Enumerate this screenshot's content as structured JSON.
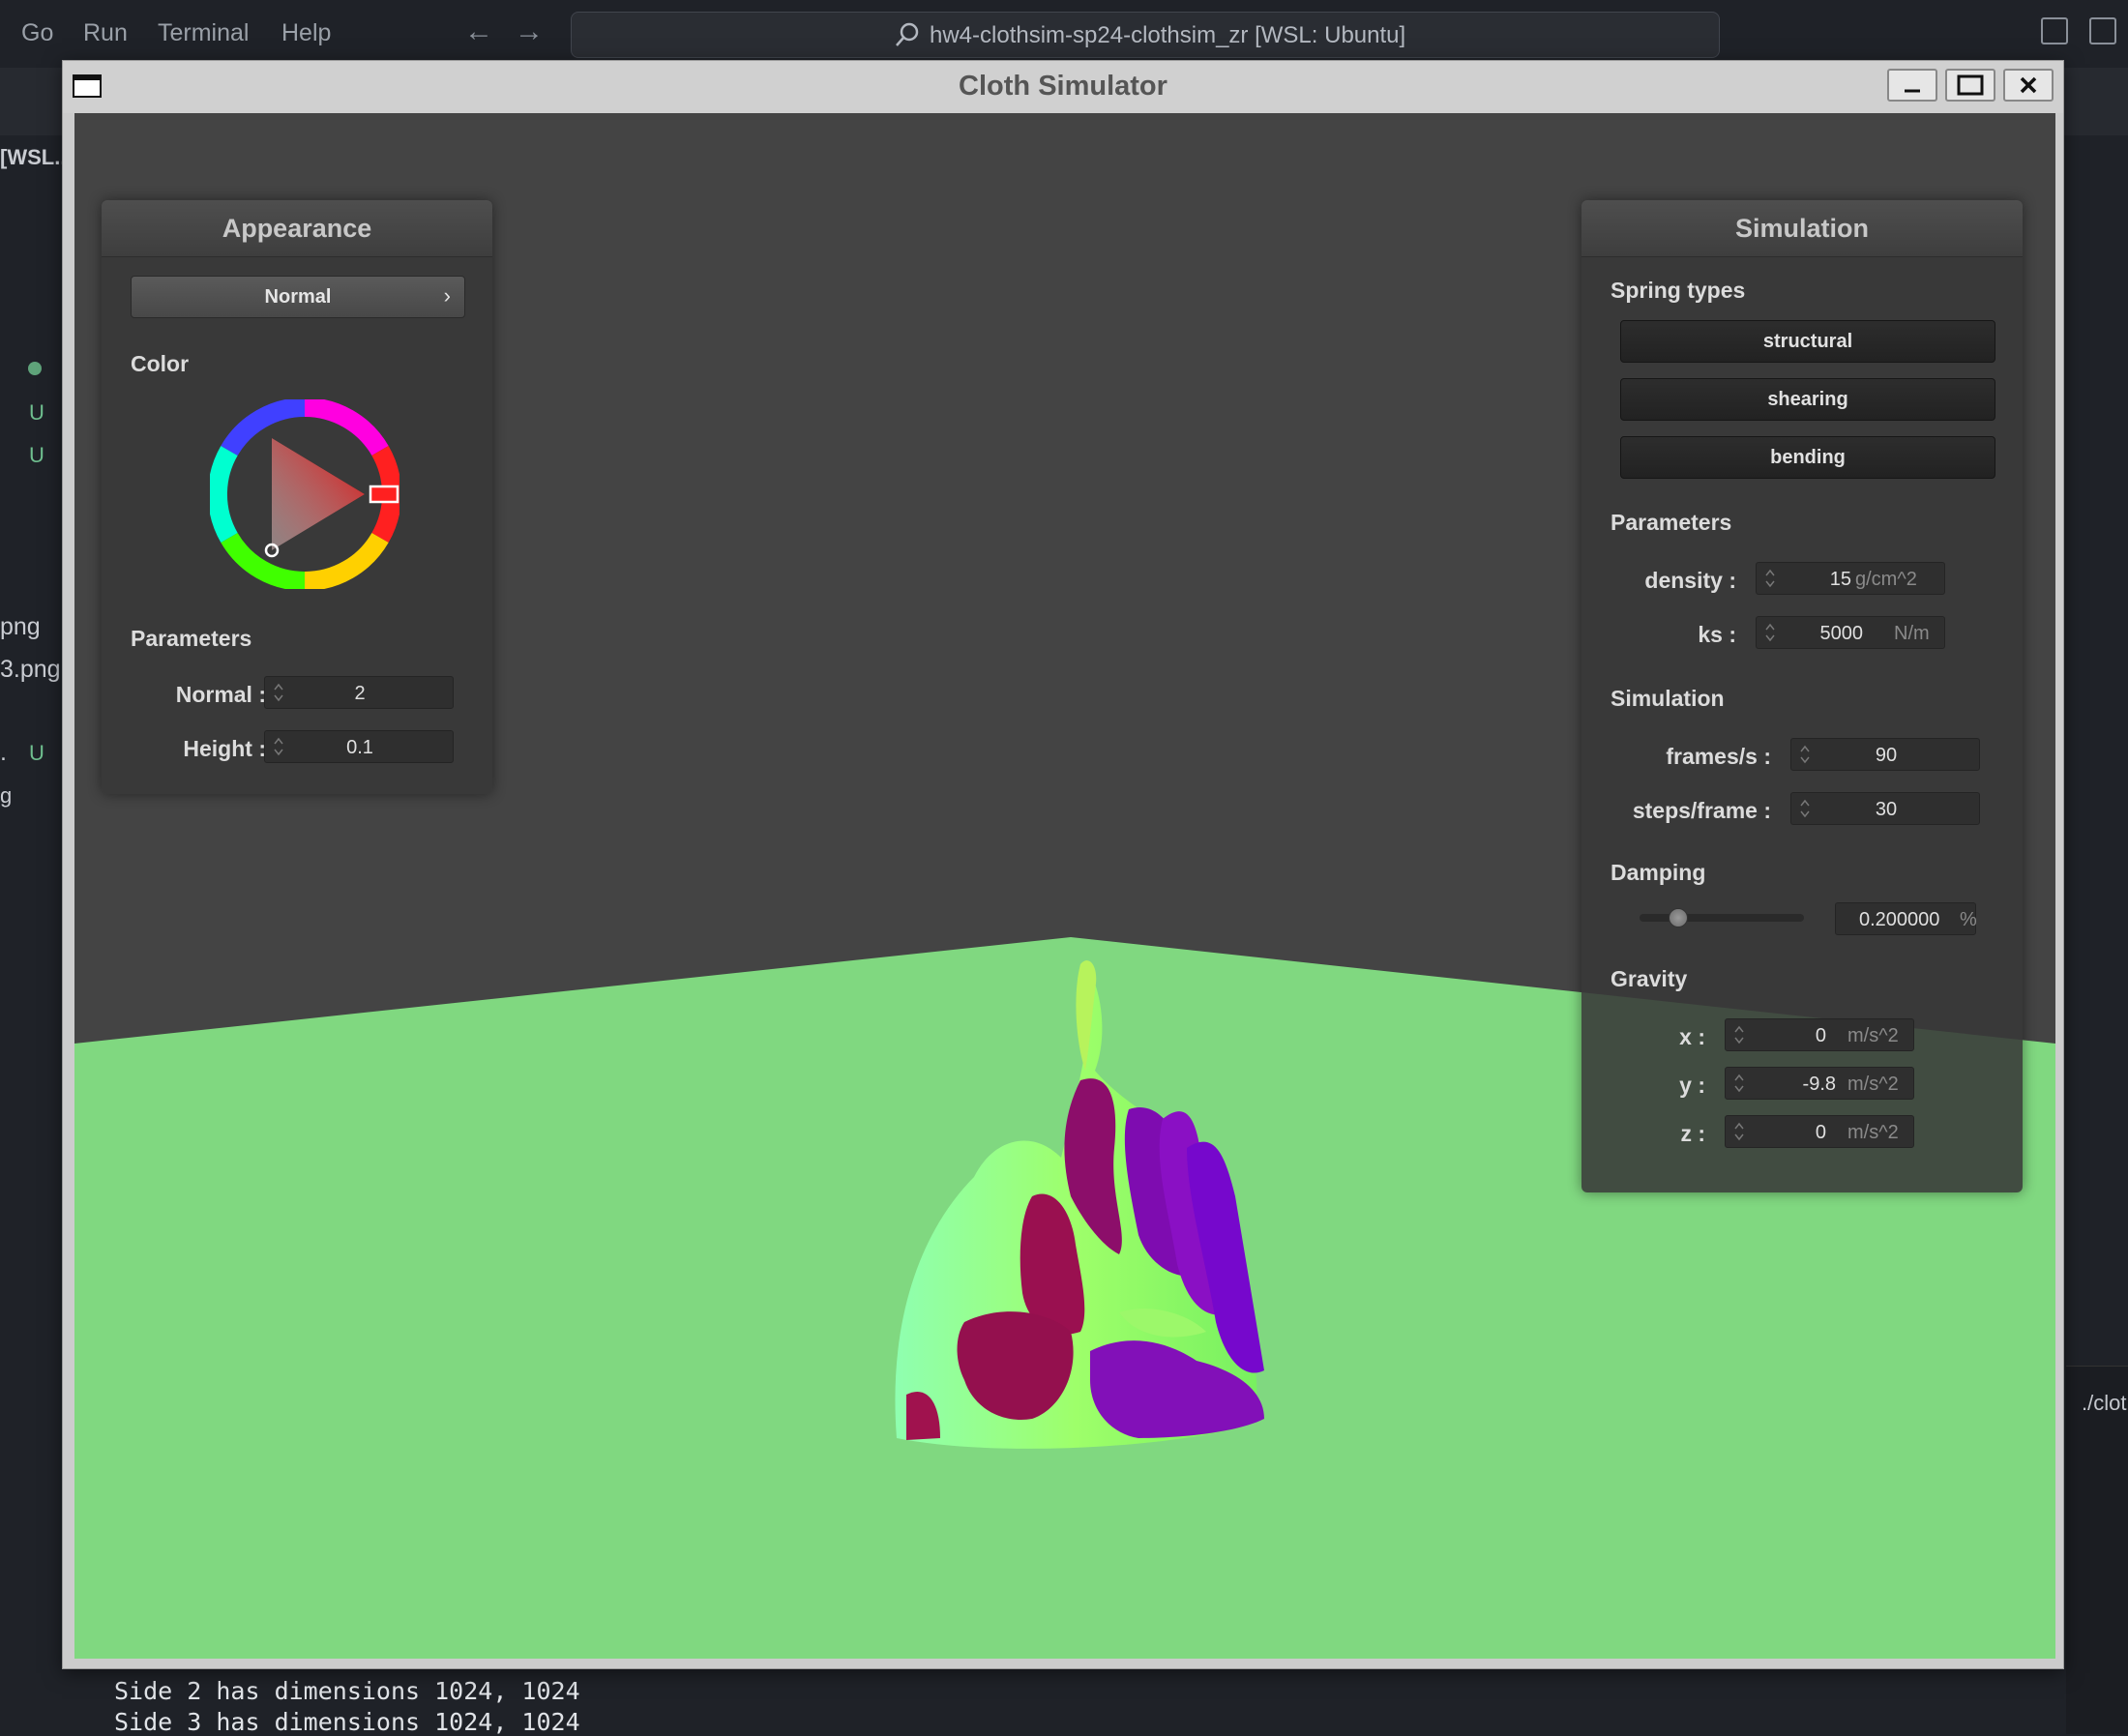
{
  "vscode": {
    "menu": [
      "Go",
      "Run",
      "Terminal",
      "Help"
    ],
    "search_text": "hw4-clothsim-sp24-clothsim_zr [WSL: Ubuntu]",
    "sidebar_header": "[WSL...",
    "sidebar_files": [
      "png",
      "3.png"
    ],
    "sidebar_status_u": "U",
    "sidebar_dot_label": ".",
    "sidebar_g": "g",
    "right_terminal_text": "./clot",
    "terminal_lines": [
      "Side 2 has dimensions 1024, 1024",
      "Side 3 has dimensions 1024, 1024"
    ]
  },
  "window": {
    "title": "Cloth Simulator"
  },
  "appearance": {
    "header": "Appearance",
    "shader_dropdown": "Normal",
    "shader_arrow": "›",
    "color_label": "Color",
    "selected_color": "#ff0000",
    "parameters_label": "Parameters",
    "normal_label": "Normal :",
    "normal_value": "2",
    "height_label": "Height :",
    "height_value": "0.1"
  },
  "simulation": {
    "header": "Simulation",
    "spring_types_label": "Spring types",
    "springs": [
      "structural",
      "shearing",
      "bending"
    ],
    "parameters_label": "Parameters",
    "density_label": "density :",
    "density_value": "15",
    "density_unit": "g/cm^2",
    "ks_label": "ks :",
    "ks_value": "5000",
    "ks_unit": "N/m",
    "simulation_label": "Simulation",
    "fps_label": "frames/s :",
    "fps_value": "90",
    "steps_label": "steps/frame :",
    "steps_value": "30",
    "damping_label": "Damping",
    "damping_value": "0.200000",
    "damping_unit": "%",
    "damping_fraction": 0.2,
    "gravity_label": "Gravity",
    "gx_label": "x :",
    "gx_value": "0",
    "gy_label": "y :",
    "gy_value": "-9.8",
    "gz_label": "z :",
    "gz_value": "0",
    "gravity_unit": "m/s^2"
  },
  "colors": {
    "ground": "#80d880",
    "sky": "#444444",
    "panel": "#383838"
  }
}
